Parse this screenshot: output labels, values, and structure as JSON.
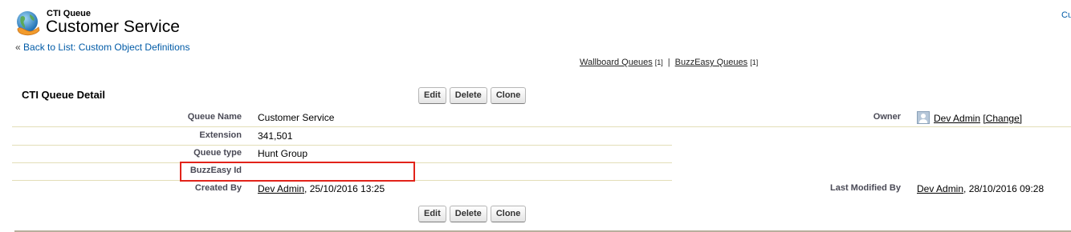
{
  "header": {
    "object_type": "CTI Queue",
    "record_name": "Customer Service",
    "corner_link": "Cu",
    "back_link_prefix": "«",
    "back_link": "Back to List: Custom Object Definitions",
    "logo_icon": "globe-phone-icon"
  },
  "related_links": [
    {
      "label": "Wallboard Queues",
      "count": "[1]"
    },
    {
      "label": "BuzzEasy Queues",
      "count": "[1]"
    }
  ],
  "related_separator": "|",
  "detail": {
    "section_title": "CTI Queue Detail",
    "buttons": {
      "edit": "Edit",
      "delete": "Delete",
      "clone": "Clone"
    },
    "fields": {
      "queue_name": {
        "label": "Queue Name",
        "value": "Customer Service"
      },
      "extension": {
        "label": "Extension",
        "value": "341,501"
      },
      "queue_type": {
        "label": "Queue type",
        "value": "Hunt Group"
      },
      "buzzeasy_id": {
        "label": "BuzzEasy Id",
        "value": ""
      },
      "created_by": {
        "label": "Created By",
        "user": "Dev Admin",
        "date": ", 25/10/2016 13:25"
      },
      "owner": {
        "label": "Owner",
        "user": "Dev Admin",
        "change": "[Change]",
        "icon": "user-icon"
      },
      "last_modified_by": {
        "label": "Last Modified By",
        "user": "Dev Admin",
        "date": ", 28/10/2016 09:28"
      }
    }
  },
  "colors": {
    "link": "#015ba7",
    "highlight": "#e2231a",
    "row_divider": "#e3deb8"
  }
}
